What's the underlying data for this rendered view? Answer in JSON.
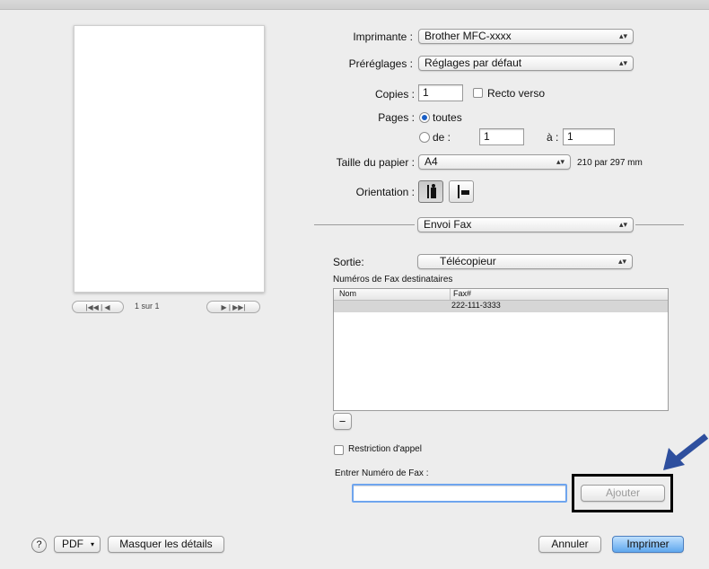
{
  "printer": {
    "label": "Imprimante :",
    "value": "Brother MFC-xxxx"
  },
  "presets": {
    "label": "Préréglages :",
    "value": "Réglages par défaut"
  },
  "copies": {
    "label": "Copies :",
    "value": "1",
    "duplex_label": "Recto verso"
  },
  "pages": {
    "label": "Pages :",
    "all_label": "toutes",
    "from_label": "de :",
    "from_value": "1",
    "to_label": "à :",
    "to_value": "1"
  },
  "paper": {
    "label": "Taille du papier :",
    "value": "A4",
    "size_text": "210 par 297 mm"
  },
  "orientation": {
    "label": "Orientation :"
  },
  "section": {
    "value": "Envoi Fax"
  },
  "output": {
    "label": "Sortie:",
    "value": "Télécopieur"
  },
  "recipients": {
    "label": "Numéros de Fax destinataires",
    "columns": [
      "Nom",
      "Fax#"
    ],
    "rows": [
      {
        "name": "",
        "fax": "222-111-3333"
      }
    ]
  },
  "minus_label": "−",
  "restriction": {
    "label": "Restriction d'appel"
  },
  "fax_entry": {
    "label": "Entrer Numéro de Fax :",
    "value": "",
    "add_label": "Ajouter"
  },
  "pager": {
    "label": "1 sur 1",
    "first_prev": "|◀◀ | ◀",
    "next_last": "▶ | ▶▶|"
  },
  "footer": {
    "help": "?",
    "pdf_label": "PDF",
    "hide_details": "Masquer les détails",
    "cancel": "Annuler",
    "print": "Imprimer"
  },
  "colors": {
    "accent": "#1a5fc6",
    "annotation_arrow": "#2e4f9e"
  }
}
